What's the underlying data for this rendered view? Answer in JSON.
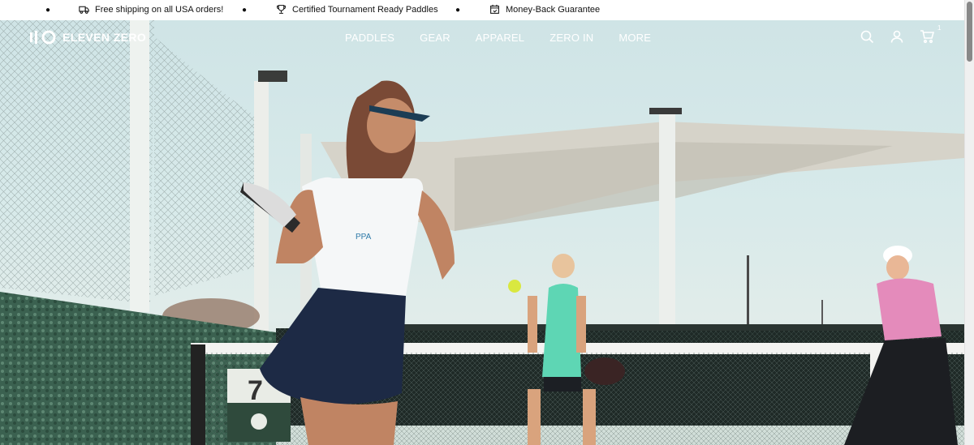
{
  "announcement": {
    "items": [
      {
        "text": "Free shipping on all USA orders!",
        "icon": "truck-icon"
      },
      {
        "text": "Certified Tournament Ready Paddles",
        "icon": "trophy-icon"
      },
      {
        "text": "Money-Back Guarantee",
        "icon": "calendar-refund-icon"
      }
    ]
  },
  "header": {
    "logo_text": "ELEVEN ZERO",
    "nav": [
      "PADDLES",
      "GEAR",
      "APPAREL",
      "ZERO IN",
      "MORE"
    ],
    "cart_count": "1"
  },
  "hero": {
    "scene": "pickleball-players-on-court",
    "colors": {
      "sky": "#cfe4e6",
      "hedge": "#3d6550",
      "skirt": "#1d2a45",
      "pink": "#e48bbb",
      "teal": "#6ad8b8"
    }
  }
}
